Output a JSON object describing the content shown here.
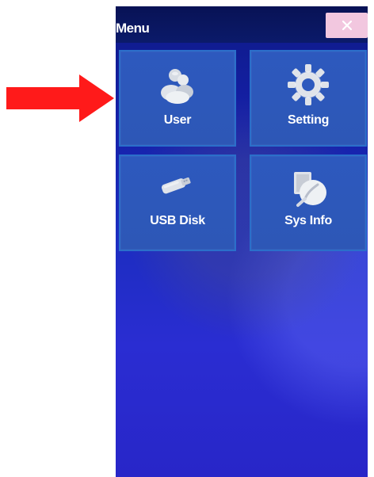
{
  "window": {
    "title": "Menu"
  },
  "menu": {
    "items": [
      {
        "label": "User",
        "icon": "users-icon"
      },
      {
        "label": "Setting",
        "icon": "gear-icon"
      },
      {
        "label": "USB Disk",
        "icon": "usb-drive-icon"
      },
      {
        "label": "Sys Info",
        "icon": "system-info-icon"
      }
    ]
  },
  "controls": {
    "close_icon": "close-icon"
  },
  "annotation": {
    "arrow_icon": "red-arrow-icon",
    "arrow_color": "#ff1a1a"
  },
  "colors": {
    "background": "#1b2dbf",
    "tile": "#2d59be",
    "tile_border": "#2b6fca",
    "text": "#ffffff",
    "close_button": "#f2c7df"
  }
}
